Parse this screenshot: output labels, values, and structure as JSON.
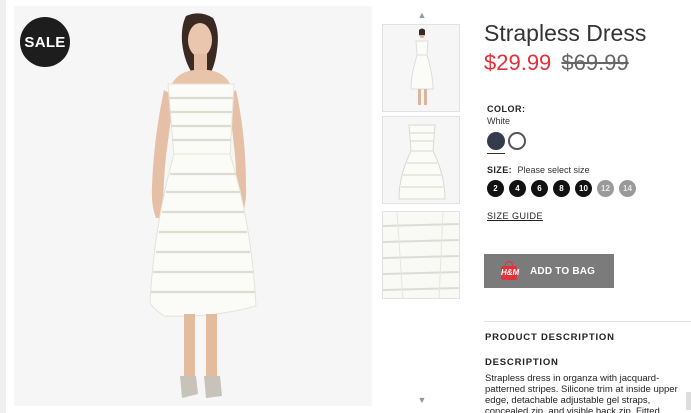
{
  "badge": "SALE",
  "gallery": {
    "up_arrow": "▲",
    "down_arrow": "▼"
  },
  "product": {
    "title": "Strapless Dress",
    "price_sale": "$29.99",
    "price_original": "$69.99",
    "color_label": "COLOR:",
    "color_value": "White",
    "swatches": [
      {
        "name": "Dark blue",
        "hex": "#353b4d"
      },
      {
        "name": "White",
        "hex": "#ffffff"
      }
    ],
    "size_label": "SIZE:",
    "size_hint": "Please select size",
    "sizes": [
      {
        "label": "2",
        "available": true
      },
      {
        "label": "4",
        "available": true
      },
      {
        "label": "6",
        "available": true
      },
      {
        "label": "8",
        "available": true
      },
      {
        "label": "10",
        "available": true
      },
      {
        "label": "12",
        "available": false
      },
      {
        "label": "14",
        "available": false
      }
    ],
    "size_guide": "SIZE GUIDE",
    "add_to_bag": "ADD TO BAG",
    "bag_icon_letters": "H&M"
  },
  "description": {
    "section_heading": "PRODUCT DESCRIPTION",
    "heading": "DESCRIPTION",
    "text": "Strapless dress in organza with jacquard-patterned stripes. Silicone trim at inside upper edge, detachable adjustable gel straps, concealed zip, and visible back zip. Fitted bodice, seam at waist, and flared skirt. Lined."
  },
  "colors": {
    "sale_price": "#e0303a",
    "button": "#7b7b7b",
    "badge": "#1d1d1d"
  }
}
